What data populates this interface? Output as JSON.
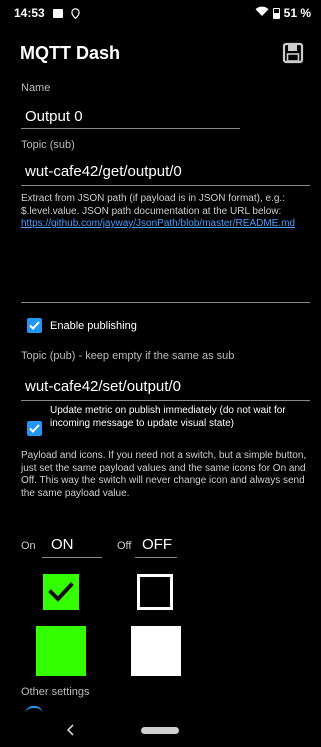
{
  "status_bar": {
    "time": "14:53",
    "battery": "51 %"
  },
  "app_bar": {
    "title": "MQTT Dash",
    "save_icon": "save-icon"
  },
  "form": {
    "name_label": "Name",
    "name_value": "Output 0",
    "topic_sub_label": "Topic (sub)",
    "topic_sub_value": "wut-cafe42/get/output/0",
    "json_help_text": "Extract from JSON path (if payload is in JSON format), e.g.: $.level.value. JSON path documentation at the URL below:",
    "json_help_link": "https://github.com/jayway/JsonPath/blob/master/README.md",
    "json_path_value": "",
    "enable_publishing_label": "Enable publishing",
    "enable_publishing_checked": true,
    "topic_pub_label": "Topic (pub) - keep empty if the same as sub",
    "topic_pub_value": "wut-cafe42/set/output/0",
    "update_metric_label": "Update metric on publish immediately (do not wait for incoming message to update visual state)",
    "update_metric_checked": true,
    "payload_help": "Payload and icons. If you need not a switch, but a simple button, just set the same payload values and the same icons for On and Off. This way the switch will never change icon and always send the same payload value.",
    "on_label": "On",
    "on_value": "ON",
    "off_label": "Off",
    "off_value": "OFF",
    "on_color": "#33ff00",
    "off_color": "#ffffff",
    "other_settings_label": "Other settings"
  },
  "nav": {
    "back_icon": "back-icon",
    "home_icon": "home-pill-icon"
  }
}
